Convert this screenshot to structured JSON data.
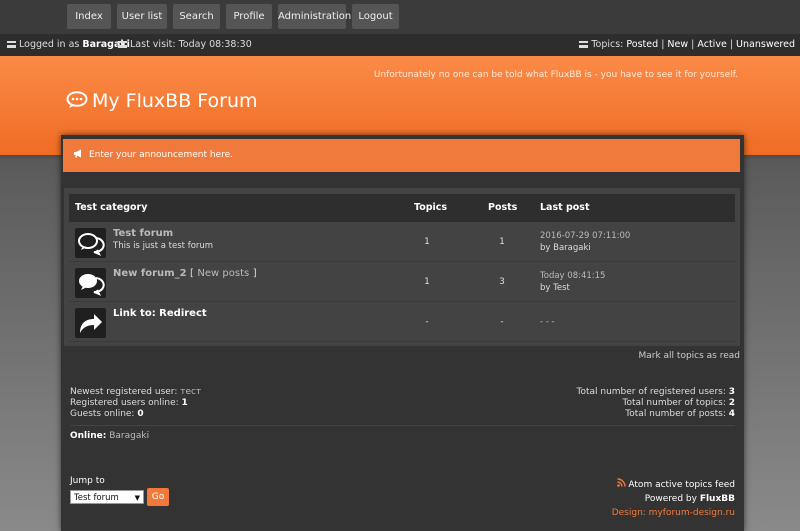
{
  "nav": {
    "items": [
      "Index",
      "User list",
      "Search",
      "Profile",
      "Administration",
      "Logout"
    ]
  },
  "status": {
    "logged_prefix": "Logged in as",
    "username": "Baragaki",
    "last_visit": "Last visit: Today 08:38:30",
    "topics_prefix": "Topics:",
    "links": [
      "Posted",
      "New",
      "Active",
      "Unanswered"
    ],
    "separator": " | "
  },
  "header": {
    "title": "My FluxBB Forum",
    "description": "Unfortunately no one can be told what FluxBB is - you have to see it for yourself."
  },
  "announcement": {
    "text": "Enter your announcement here."
  },
  "table": {
    "columns": [
      "Test category",
      "Topics",
      "Posts",
      "Last post"
    ],
    "rows": [
      {
        "name": "Test forum",
        "new_posts": "",
        "desc": "This is just a test forum",
        "topics": "1",
        "posts": "1",
        "last_post_line1": "2016-07-29 07:11:00",
        "last_post_line2": "by Baragaki"
      },
      {
        "name": "New forum_2",
        "new_posts": "New posts",
        "desc": "",
        "topics": "1",
        "posts": "3",
        "last_post_line1": "Today 08:41:15",
        "last_post_line2": "by Test"
      },
      {
        "name": "Link to: Redirect",
        "new_posts": "",
        "desc": "",
        "topics": "-",
        "posts": "-",
        "last_post_line1": "- - -",
        "last_post_line2": ""
      }
    ]
  },
  "mark_all": "Mark all topics as read",
  "stats": {
    "newest_label": "Newest registered user:",
    "newest_value": "тест",
    "reg_online_label": "Registered users online:",
    "reg_online_value": "1",
    "guests_label": "Guests online:",
    "guests_value": "0",
    "total_users_label": "Total number of registered users:",
    "total_users_value": "3",
    "total_topics_label": "Total number of topics:",
    "total_topics_value": "2",
    "total_posts_label": "Total number of posts:",
    "total_posts_value": "4"
  },
  "online": {
    "label": "Online:",
    "users": "Baragaki"
  },
  "footer": {
    "jump_label": "Jump to",
    "jump_selected": "Test forum",
    "go_label": "Go",
    "feed": "Atom active topics feed",
    "powered_prefix": "Powered by",
    "powered_name": "FluxBB",
    "design": "Design: myforum-design.ru"
  },
  "colors": {
    "accent": "#f07a3c",
    "header_top": "#fb8a47",
    "panel": "#333333"
  }
}
